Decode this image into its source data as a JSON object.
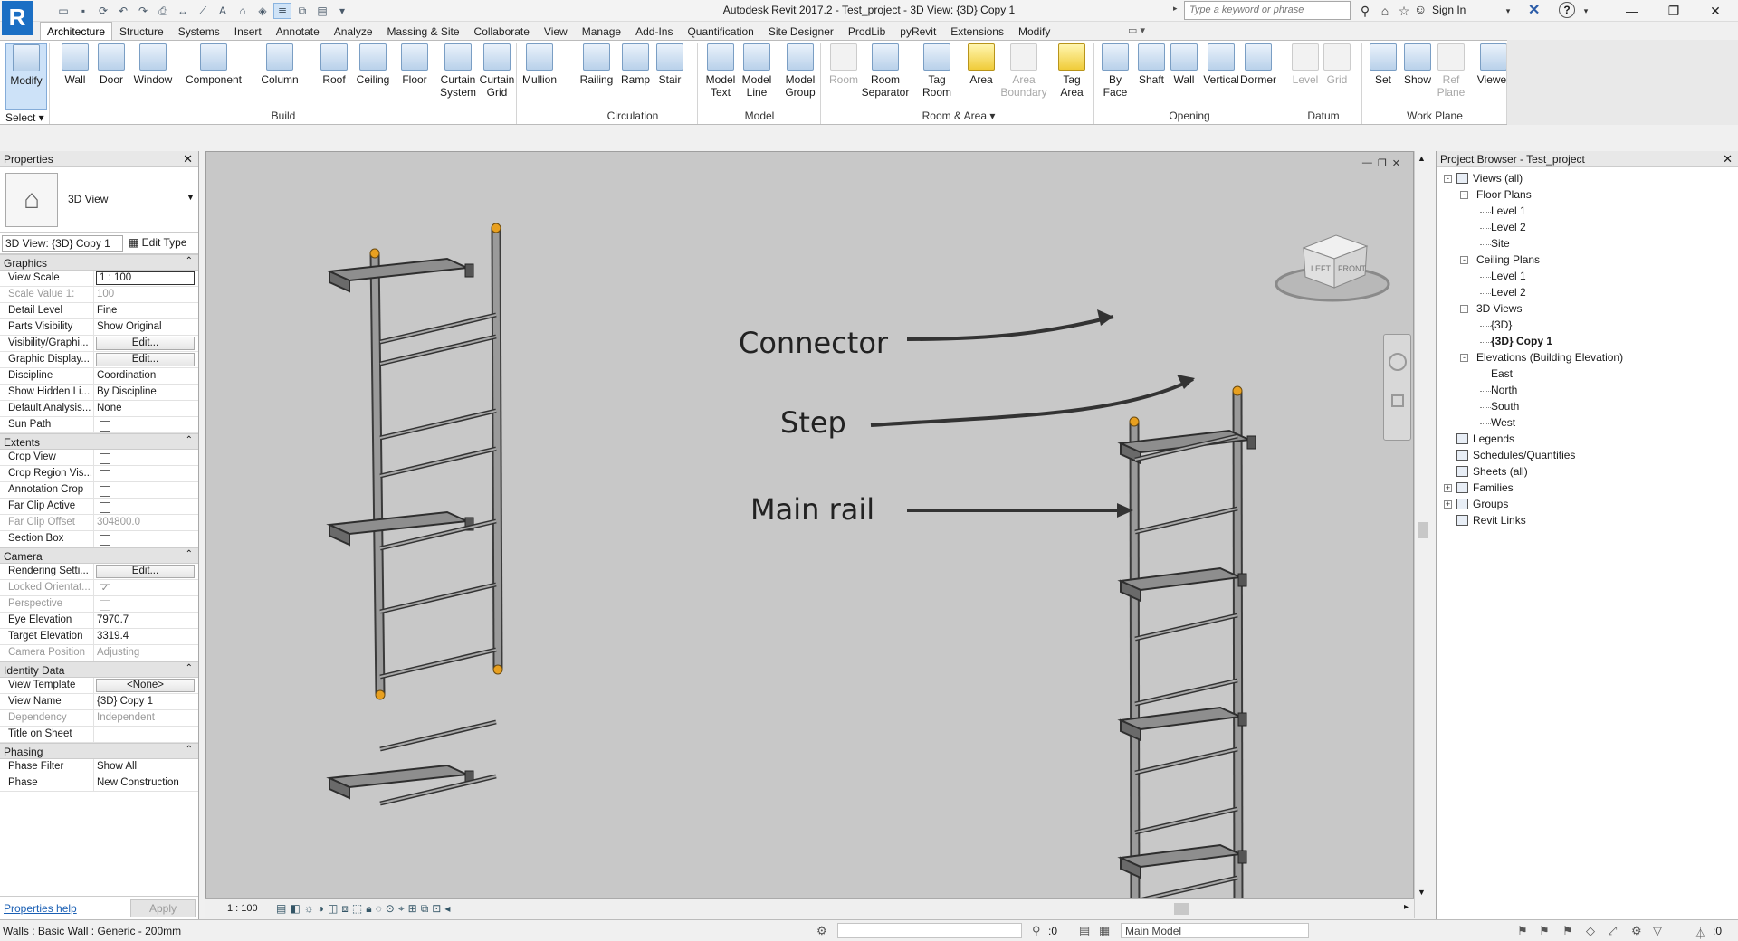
{
  "titlebar": {
    "title": "Autodesk Revit 2017.2 -    Test_project - 3D View: {3D} Copy 1",
    "search_placeholder": "Type a keyword or phrase",
    "sign_in": "Sign In",
    "logo_letter": "R"
  },
  "ribbon_tabs": [
    "Architecture",
    "Structure",
    "Systems",
    "Insert",
    "Annotate",
    "Analyze",
    "Massing & Site",
    "Collaborate",
    "View",
    "Manage",
    "Add-Ins",
    "Quantification",
    "Site Designer",
    "ProdLib",
    "pyRevit",
    "Extensions",
    "Modify"
  ],
  "ribbon": {
    "modify": "Modify",
    "select": "Select ▾",
    "build": [
      "Wall",
      "Door",
      "Window",
      "Component",
      "Column",
      "Roof",
      "Ceiling",
      "Floor",
      "Curtain System",
      "Curtain Grid",
      "Mullion"
    ],
    "circulation": [
      "Railing",
      "Ramp",
      "Stair"
    ],
    "model": [
      "Model Text",
      "Model Line",
      "Model Group"
    ],
    "room_area": [
      "Room",
      "Room Separator",
      "Tag Room",
      "Area",
      "Area Boundary",
      "Tag Area"
    ],
    "opening": [
      "By Face",
      "Shaft",
      "Wall",
      "Vertical",
      "Dormer"
    ],
    "datum": [
      "Level",
      "Grid"
    ],
    "work_plane": [
      "Set",
      "Show",
      "Ref Plane",
      "Viewer"
    ],
    "panels": [
      "Build",
      "Circulation",
      "Model",
      "Room & Area ▾",
      "Opening",
      "Datum",
      "Work Plane"
    ]
  },
  "properties": {
    "title": "Properties",
    "type_name": "3D View",
    "view_selector": "3D View: {3D} Copy 1",
    "edit_type": "Edit Type",
    "groups": [
      {
        "name": "Graphics",
        "rows": [
          [
            "View Scale",
            "1 : 100",
            "input"
          ],
          [
            "Scale Value    1:",
            "100",
            "ro"
          ],
          [
            "Detail Level",
            "Fine",
            ""
          ],
          [
            "Parts Visibility",
            "Show Original",
            ""
          ],
          [
            "Visibility/Graphi...",
            "Edit...",
            "btn"
          ],
          [
            "Graphic Display...",
            "Edit...",
            "btn"
          ],
          [
            "Discipline",
            "Coordination",
            ""
          ],
          [
            "Show Hidden Li...",
            "By Discipline",
            ""
          ],
          [
            "Default Analysis...",
            "None",
            ""
          ],
          [
            "Sun Path",
            "",
            "cb"
          ]
        ]
      },
      {
        "name": "Extents",
        "rows": [
          [
            "Crop View",
            "",
            "cb"
          ],
          [
            "Crop Region Vis...",
            "",
            "cb"
          ],
          [
            "Annotation Crop",
            "",
            "cb"
          ],
          [
            "Far Clip Active",
            "",
            "cb"
          ],
          [
            "Far Clip Offset",
            "304800.0",
            "ro"
          ],
          [
            "Section Box",
            "",
            "cb"
          ]
        ]
      },
      {
        "name": "Camera",
        "rows": [
          [
            "Rendering Setti...",
            "Edit...",
            "btn"
          ],
          [
            "Locked Orientat...",
            "✓",
            "cbro"
          ],
          [
            "Perspective",
            "",
            "cbro"
          ],
          [
            "Eye Elevation",
            "7970.7",
            ""
          ],
          [
            "Target Elevation",
            "3319.4",
            ""
          ],
          [
            "Camera Position",
            "Adjusting",
            "ro"
          ]
        ]
      },
      {
        "name": "Identity Data",
        "rows": [
          [
            "View Template",
            "<None>",
            "btn"
          ],
          [
            "View Name",
            "{3D} Copy 1",
            ""
          ],
          [
            "Dependency",
            "Independent",
            "ro"
          ],
          [
            "Title on Sheet",
            "",
            ""
          ]
        ]
      },
      {
        "name": "Phasing",
        "rows": [
          [
            "Phase Filter",
            "Show All",
            ""
          ],
          [
            "Phase",
            "New Construction",
            ""
          ]
        ]
      }
    ],
    "help_link": "Properties help",
    "apply": "Apply"
  },
  "view": {
    "annotations": [
      {
        "text": "Connector"
      },
      {
        "text": "Step"
      },
      {
        "text": "Main rail"
      }
    ],
    "viewcube": {
      "left": "LEFT",
      "front": "FRONT"
    },
    "scale": "1 : 100"
  },
  "project_browser": {
    "title": "Project Browser - Test_project",
    "nodes": [
      {
        "label": "Views (all)",
        "level": 0,
        "exp": "-"
      },
      {
        "label": "Floor Plans",
        "level": 1,
        "exp": "-"
      },
      {
        "label": "Level 1",
        "level": 2
      },
      {
        "label": "Level 2",
        "level": 2
      },
      {
        "label": "Site",
        "level": 2
      },
      {
        "label": "Ceiling Plans",
        "level": 1,
        "exp": "-"
      },
      {
        "label": "Level 1",
        "level": 2
      },
      {
        "label": "Level 2",
        "level": 2
      },
      {
        "label": "3D Views",
        "level": 1,
        "exp": "-"
      },
      {
        "label": "{3D}",
        "level": 2
      },
      {
        "label": "{3D} Copy 1",
        "level": 2,
        "bold": true
      },
      {
        "label": "Elevations (Building Elevation)",
        "level": 1,
        "exp": "-"
      },
      {
        "label": "East",
        "level": 2
      },
      {
        "label": "North",
        "level": 2
      },
      {
        "label": "South",
        "level": 2
      },
      {
        "label": "West",
        "level": 2
      },
      {
        "label": "Legends",
        "level": 0,
        "icon": true
      },
      {
        "label": "Schedules/Quantities",
        "level": 0,
        "icon": true
      },
      {
        "label": "Sheets (all)",
        "level": 0,
        "icon": true
      },
      {
        "label": "Families",
        "level": 0,
        "exp": "+",
        "icon": true
      },
      {
        "label": "Groups",
        "level": 0,
        "exp": "+",
        "icon": true
      },
      {
        "label": "Revit Links",
        "level": 0,
        "icon": true
      }
    ]
  },
  "status": {
    "text": "Walls : Basic Wall : Generic - 200mm",
    "worksets_count": ":0",
    "model": "Main Model",
    "filter_count": ":0"
  }
}
